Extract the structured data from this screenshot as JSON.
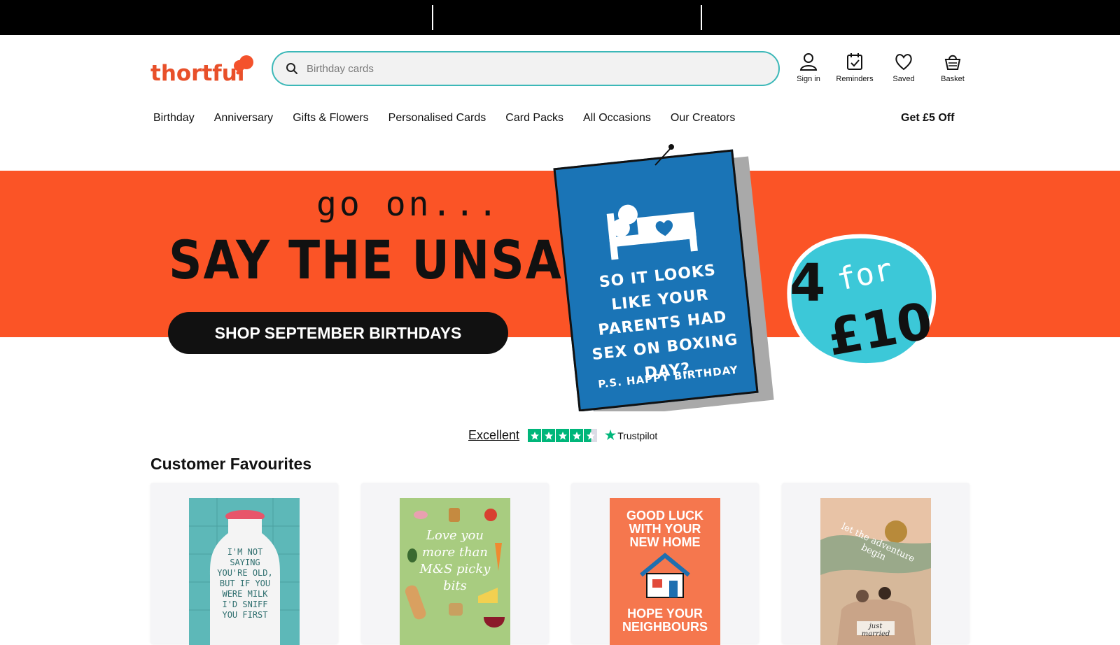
{
  "header": {
    "logo_text": "thortful",
    "search": {
      "placeholder": "Birthday cards"
    },
    "icons": [
      {
        "label": "Sign in",
        "icon": "user-icon"
      },
      {
        "label": "Reminders",
        "icon": "calendar-check-icon"
      },
      {
        "label": "Saved",
        "icon": "heart-icon"
      },
      {
        "label": "Basket",
        "icon": "basket-icon"
      }
    ]
  },
  "nav": {
    "items": [
      "Birthday",
      "Anniversary",
      "Gifts & Flowers",
      "Personalised Cards",
      "Card Packs",
      "All Occasions",
      "Our Creators"
    ],
    "promo": "Get £5 Off"
  },
  "hero": {
    "tagline": "go on...",
    "headline": "SAY THE UNSAID",
    "cta": "SHOP SEPTEMBER BIRTHDAYS",
    "card_message": "SO IT LOOKS LIKE YOUR PARENTS HAD SEX ON BOXING DAY?",
    "card_ps": "P.S. HAPPY BIRTHDAY",
    "offer_number": "4",
    "offer_for": "for",
    "offer_price": "£10",
    "colors": {
      "stripe": "#fb5426",
      "card": "#1a74b6",
      "offer": "#3cc8d8"
    }
  },
  "trustpilot": {
    "rating_label": "Excellent",
    "brand": "Trustpilot",
    "stars": 4.5
  },
  "section": {
    "title": "Customer Favourites",
    "products": [
      {
        "card_text": "I'M NOT SAYING YOU'RE OLD, BUT IF YOU WERE MILK I'D SNIFF YOU FIRST"
      },
      {
        "card_text": "Love you more than M&S picky bits"
      },
      {
        "card_text_top": "GOOD LUCK WITH YOUR NEW HOME",
        "card_text_bottom": "HOPE YOUR NEIGHBOURS"
      },
      {
        "card_text_top": "let the adventure begin",
        "card_text_bottom": "just married"
      }
    ]
  }
}
